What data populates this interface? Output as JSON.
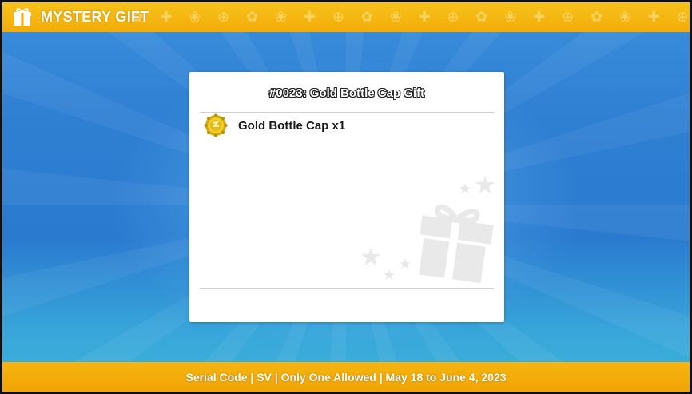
{
  "header": {
    "title": "MYSTERY GIFT",
    "icon": "gift-icon"
  },
  "card": {
    "title": "#0023: Gold Bottle Cap Gift",
    "items": [
      {
        "icon": "gold-bottle-cap-icon",
        "label": "Gold Bottle Cap x1"
      }
    ]
  },
  "footer": {
    "text": "Serial Code | SV | Only One Allowed | May 18 to June 4, 2023"
  },
  "colors": {
    "bar": "#f4b00e",
    "background": "#2f7fd3",
    "card": "#ffffff"
  }
}
